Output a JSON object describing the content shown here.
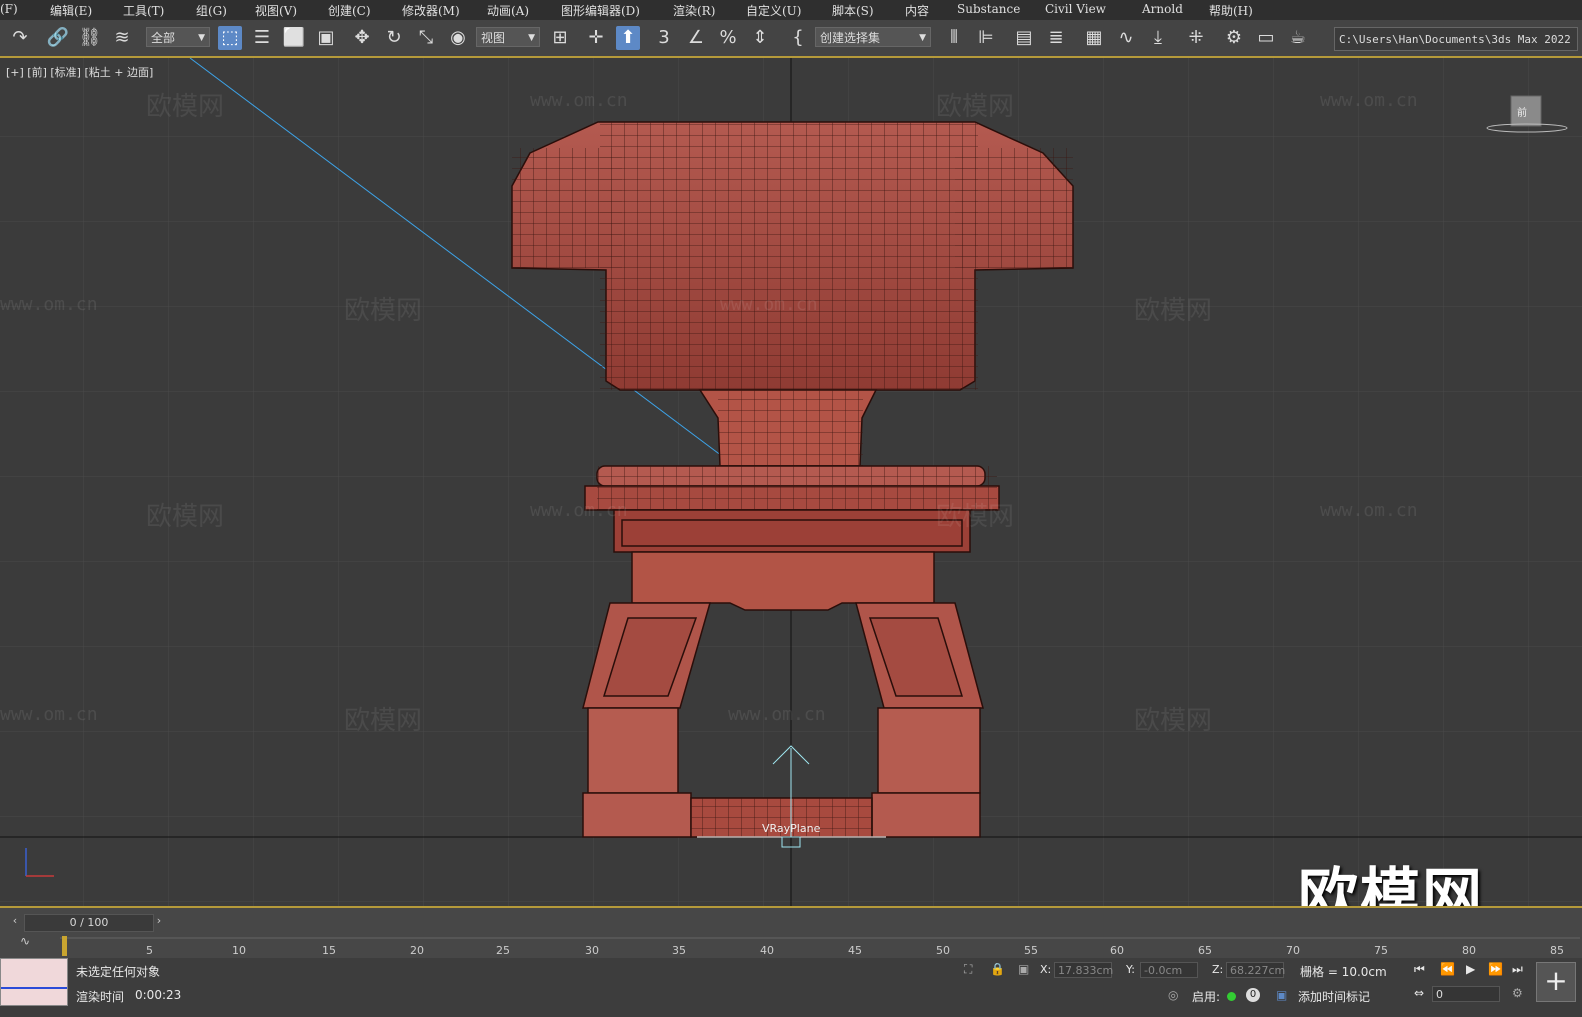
{
  "menu": [
    "(F)",
    "编辑(E)",
    "工具(T)",
    "组(G)",
    "视图(V)",
    "创建(C)",
    "修改器(M)",
    "动画(A)",
    "图形编辑器(D)",
    "渲染(R)",
    "自定义(U)",
    "脚本(S)",
    "内容",
    "Substance",
    "Civil View",
    "Arnold",
    "帮助(H)"
  ],
  "toolbar": {
    "selection_filter": "全部",
    "coord_system": "视图",
    "named_selection": "创建选择集",
    "project_path": "C:\\Users\\Han\\Documents\\3ds Max 2022"
  },
  "viewport": {
    "label": "[+] [前] [标准] [粘土 + 边面]",
    "object_label": "VRayPlane",
    "watermark_cn": "欧模网",
    "watermark_url": "www.om.cn",
    "big_watermark": "欧模网",
    "viewcube_label": "前"
  },
  "timeline": {
    "frame": "0 / 100",
    "ticks": [
      "5",
      "10",
      "15",
      "20",
      "25",
      "30",
      "35",
      "40",
      "45",
      "50",
      "55",
      "60",
      "65",
      "70",
      "75",
      "80",
      "85"
    ]
  },
  "status": {
    "selection_info": "未选定任何对象",
    "render_time_label": "渲染时间",
    "render_time": "0:00:23",
    "x_label": "X:",
    "x_value": "17.833cm",
    "y_label": "Y:",
    "y_value": "-0.0cm",
    "z_label": "Z:",
    "z_value": "68.227cm",
    "grid": "栅格 = 10.0cm",
    "enable_label": "启用:",
    "enable_count": "0",
    "add_time_tag": "添加时间标记",
    "frame_field": "0"
  },
  "colors": {
    "accent": "#b59a3a",
    "model": "#a84a40",
    "highlight": "#5d89c6"
  }
}
